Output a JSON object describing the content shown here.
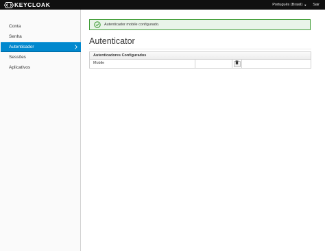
{
  "header": {
    "brand": "KEYCLOAK",
    "language": "Português (Brasil)",
    "signout": "Sair"
  },
  "sidebar": {
    "items": [
      {
        "label": "Conta"
      },
      {
        "label": "Senha"
      },
      {
        "label": "Autenticador",
        "active": true
      },
      {
        "label": "Sessões"
      },
      {
        "label": "Aplicativos"
      }
    ]
  },
  "alert": {
    "type": "success",
    "message": "Autenticador mobile configurado."
  },
  "main": {
    "title": "Autenticator",
    "table": {
      "header": "Autenticadores Configurados",
      "rows": [
        {
          "name": "Mobile"
        }
      ]
    }
  },
  "colors": {
    "navbar": "#101010",
    "active_nav": "#0088ce",
    "success": "#3f9c35"
  },
  "icons": {
    "alert": "check-circle-icon",
    "delete": "trash-icon",
    "nav_active": "chevron-right-icon",
    "language": "caret-down-icon"
  }
}
